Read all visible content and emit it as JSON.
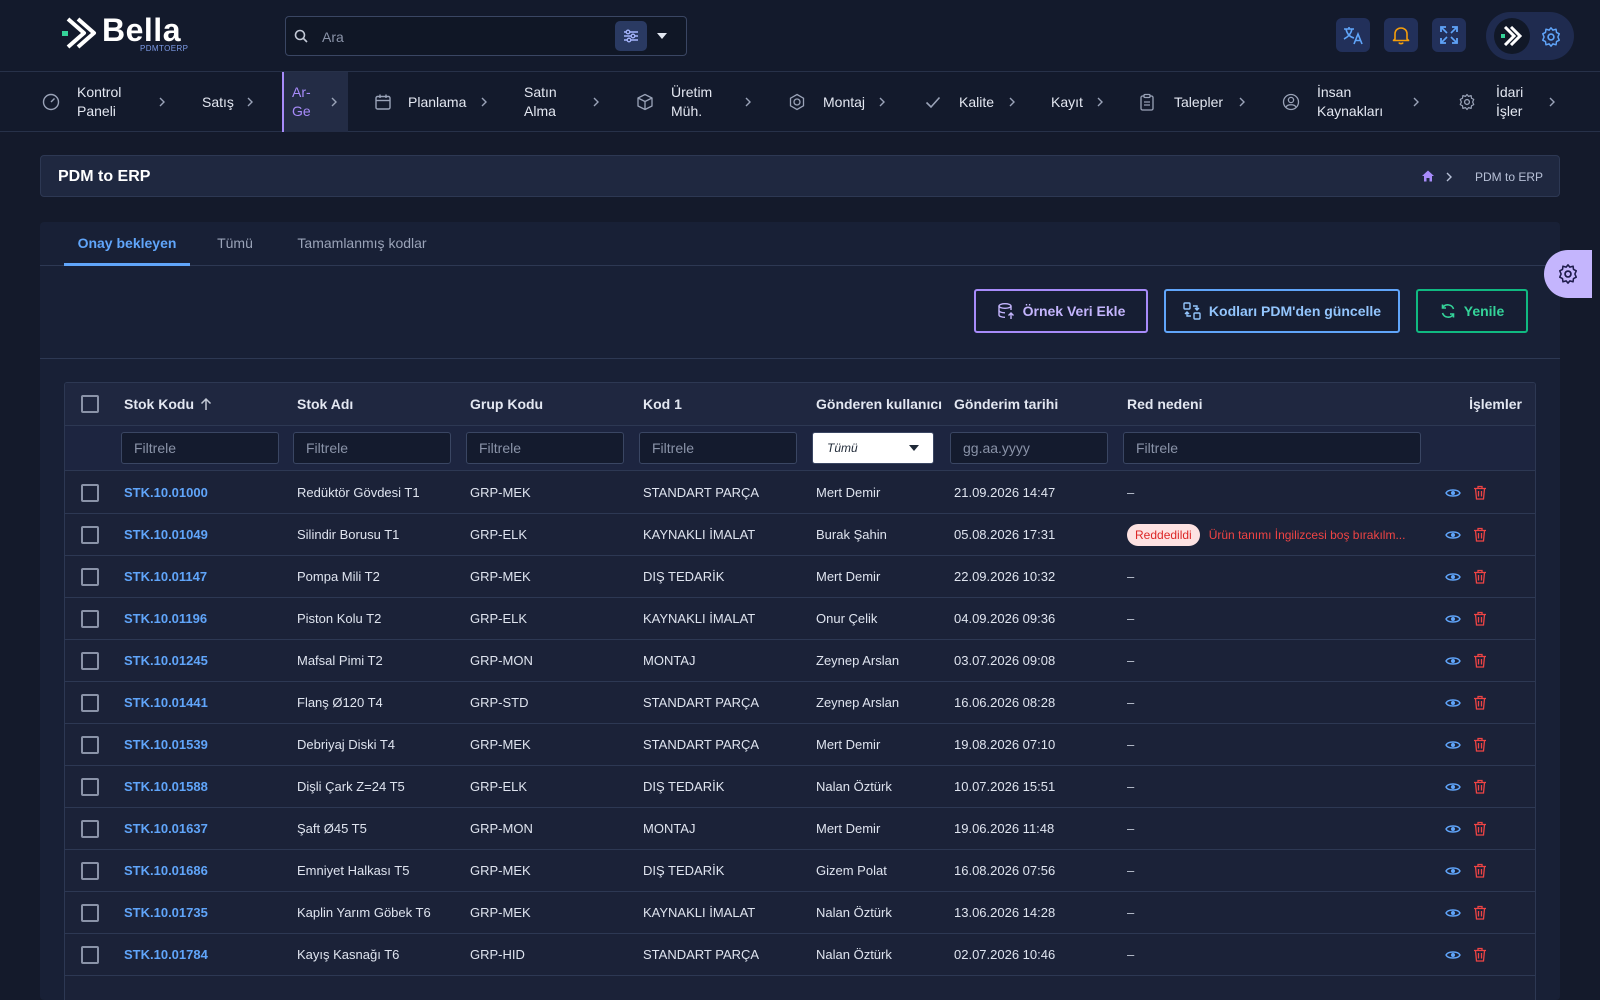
{
  "brand": {
    "name": "Bella",
    "sub": "PDMTOERP"
  },
  "search": {
    "placeholder": "Ara"
  },
  "header_icons": [
    "translate-icon",
    "bell-icon",
    "fullscreen-icon",
    "gear-icon"
  ],
  "nav": [
    {
      "label": "Kontrol Paneli",
      "icon": "dashboard-icon",
      "active": false
    },
    {
      "label": "Satış",
      "icon": "",
      "active": false
    },
    {
      "label": "Ar-Ge",
      "icon": "",
      "active": true
    },
    {
      "label": "Planlama",
      "icon": "calendar-icon",
      "active": false
    },
    {
      "label": "Satın Alma",
      "icon": "",
      "active": false
    },
    {
      "label": "Üretim Müh.",
      "icon": "cube-icon",
      "active": false
    },
    {
      "label": "Montaj",
      "icon": "hexagon-icon",
      "active": false
    },
    {
      "label": "Kalite",
      "icon": "check-icon",
      "active": false
    },
    {
      "label": "Kayıt",
      "icon": "",
      "active": false
    },
    {
      "label": "Talepler",
      "icon": "clipboard-icon",
      "active": false
    },
    {
      "label": "İnsan Kaynakları",
      "icon": "user-circle-icon",
      "active": false
    },
    {
      "label": "İdari İşler",
      "icon": "gear-icon",
      "active": false
    }
  ],
  "page": {
    "title": "PDM to ERP",
    "breadcrumb": "PDM to ERP"
  },
  "tabs": [
    {
      "label": "Onay bekleyen",
      "active": true
    },
    {
      "label": "Tümü",
      "active": false
    },
    {
      "label": "Tamamlanmış kodlar",
      "active": false
    }
  ],
  "toolbar": {
    "sample_label": "Örnek Veri Ekle",
    "update_label": "Kodları PDM'den güncelle",
    "refresh_label": "Yenile"
  },
  "table": {
    "columns": {
      "code": "Stok Kodu",
      "name": "Stok Adı",
      "group": "Grup Kodu",
      "kod1": "Kod 1",
      "user": "Gönderen kullanıcı",
      "date": "Gönderim tarihi",
      "reason": "Red nedeni",
      "actions": "İşlemler"
    },
    "filter_placeholder": "Filtrele",
    "user_filter_value": "Tümü",
    "date_filter_placeholder": "gg.aa.yyyy",
    "rows": [
      {
        "code": "STK.10.01000",
        "name": "Redüktör Gövdesi T1",
        "group": "GRP-MEK",
        "kod1": "STANDART PARÇA",
        "user": "Mert Demir",
        "date": "21.09.2026 14:47",
        "status": "",
        "reason": "–"
      },
      {
        "code": "STK.10.01049",
        "name": "Silindir Borusu T1",
        "group": "GRP-ELK",
        "kod1": "KAYNAKLI İMALAT",
        "user": "Burak Şahin",
        "date": "05.08.2026 17:31",
        "status": "Reddedildi",
        "reason": "Ürün tanımı İngilizcesi boş bırakılm..."
      },
      {
        "code": "STK.10.01147",
        "name": "Pompa Mili T2",
        "group": "GRP-MEK",
        "kod1": "DIŞ TEDARİK",
        "user": "Mert Demir",
        "date": "22.09.2026 10:32",
        "status": "",
        "reason": "–"
      },
      {
        "code": "STK.10.01196",
        "name": "Piston Kolu T2",
        "group": "GRP-ELK",
        "kod1": "KAYNAKLI İMALAT",
        "user": "Onur Çelik",
        "date": "04.09.2026 09:36",
        "status": "",
        "reason": "–"
      },
      {
        "code": "STK.10.01245",
        "name": "Mafsal Pimi T2",
        "group": "GRP-MON",
        "kod1": "MONTAJ",
        "user": "Zeynep Arslan",
        "date": "03.07.2026 09:08",
        "status": "",
        "reason": "–"
      },
      {
        "code": "STK.10.01441",
        "name": "Flanş Ø120 T4",
        "group": "GRP-STD",
        "kod1": "STANDART PARÇA",
        "user": "Zeynep Arslan",
        "date": "16.06.2026 08:28",
        "status": "",
        "reason": "–"
      },
      {
        "code": "STK.10.01539",
        "name": "Debriyaj Diski T4",
        "group": "GRP-MEK",
        "kod1": "STANDART PARÇA",
        "user": "Mert Demir",
        "date": "19.08.2026 07:10",
        "status": "",
        "reason": "–"
      },
      {
        "code": "STK.10.01588",
        "name": "Dişli Çark Z=24 T5",
        "group": "GRP-ELK",
        "kod1": "DIŞ TEDARİK",
        "user": "Nalan Öztürk",
        "date": "10.07.2026 15:51",
        "status": "",
        "reason": "–"
      },
      {
        "code": "STK.10.01637",
        "name": "Şaft Ø45 T5",
        "group": "GRP-MON",
        "kod1": "MONTAJ",
        "user": "Mert Demir",
        "date": "19.06.2026 11:48",
        "status": "",
        "reason": "–"
      },
      {
        "code": "STK.10.01686",
        "name": "Emniyet Halkası T5",
        "group": "GRP-MEK",
        "kod1": "DIŞ TEDARİK",
        "user": "Gizem Polat",
        "date": "16.08.2026 07:56",
        "status": "",
        "reason": "–"
      },
      {
        "code": "STK.10.01735",
        "name": "Kaplin Yarım Göbek T6",
        "group": "GRP-MEK",
        "kod1": "KAYNAKLI İMALAT",
        "user": "Nalan Öztürk",
        "date": "13.06.2026 14:28",
        "status": "",
        "reason": "–"
      },
      {
        "code": "STK.10.01784",
        "name": "Kayış Kasnağı T6",
        "group": "GRP-HID",
        "kod1": "STANDART PARÇA",
        "user": "Nalan Öztürk",
        "date": "02.07.2026 10:46",
        "status": "",
        "reason": "–"
      }
    ]
  },
  "colors": {
    "accent_blue": "#60a5fa",
    "accent_purple": "#a78bfa",
    "accent_green": "#10b981",
    "danger": "#ef4444"
  }
}
